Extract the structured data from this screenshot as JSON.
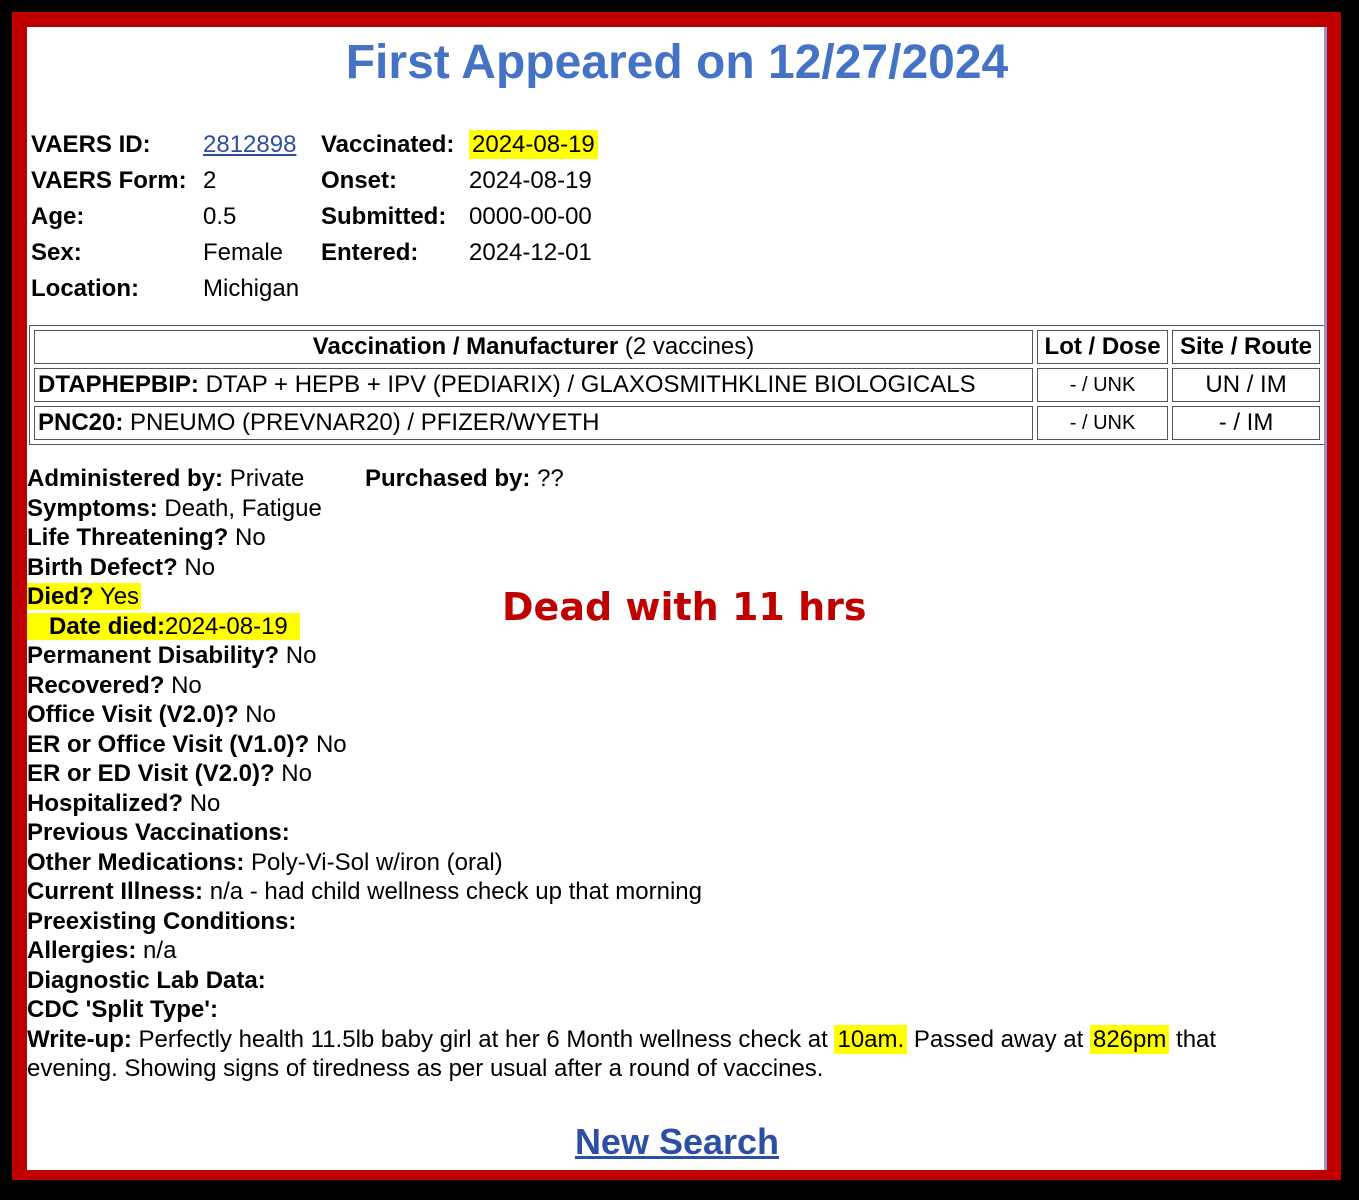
{
  "title": "First Appeared on 12/27/2024",
  "info": {
    "vaers_id_label": "VAERS ID:",
    "vaers_id": "2812898",
    "vaers_form_label": "VAERS Form:",
    "vaers_form": "2",
    "age_label": "Age:",
    "age": "0.5",
    "sex_label": "Sex:",
    "sex": "Female",
    "location_label": "Location:",
    "location": "Michigan",
    "vaccinated_label": "Vaccinated:",
    "vaccinated": "2024-08-19",
    "onset_label": "Onset:",
    "onset": "2024-08-19",
    "submitted_label": "Submitted:",
    "submitted": "0000-00-00",
    "entered_label": "Entered:",
    "entered": "2024-12-01"
  },
  "vaccines": {
    "header_main": "Vaccination / Manufacturer",
    "header_count": "(2 vaccines)",
    "header_lot": "Lot / Dose",
    "header_site": "Site / Route",
    "rows": [
      {
        "code": "DTAPHEPBIP:",
        "desc": "DTAP + HEPB + IPV (PEDIARIX) / GLAXOSMITHKLINE BIOLOGICALS",
        "lot": "- / UNK",
        "site": "UN / IM"
      },
      {
        "code": "PNC20:",
        "desc": "PNEUMO (PREVNAR20) / PFIZER/WYETH",
        "lot": "- / UNK",
        "site": "- / IM"
      }
    ]
  },
  "details": {
    "administered_label": "Administered by:",
    "administered": "Private",
    "purchased_label": "Purchased by:",
    "purchased": "??",
    "symptoms_label": "Symptoms:",
    "symptoms": "Death, Fatigue",
    "life_threatening_label": "Life Threatening?",
    "life_threatening": "No",
    "birth_defect_label": "Birth Defect?",
    "birth_defect": "No",
    "died_label": "Died?",
    "died": "Yes",
    "date_died_label": "Date died:",
    "date_died": "2024-08-19",
    "permanent_disability_label": "Permanent Disability?",
    "permanent_disability": "No",
    "recovered_label": "Recovered?",
    "recovered": "No",
    "office_visit_label": "Office Visit (V2.0)?",
    "office_visit": "No",
    "er_office_label": "ER or Office Visit (V1.0)?",
    "er_office": "No",
    "er_ed_label": "ER or ED Visit (V2.0)?",
    "er_ed": "No",
    "hospitalized_label": "Hospitalized?",
    "hospitalized": "No",
    "previous_vaccinations_label": "Previous Vaccinations:",
    "other_medications_label": "Other Medications:",
    "other_medications": "Poly-Vi-Sol w/iron (oral)",
    "current_illness_label": "Current Illness:",
    "current_illness": "n/a - had child wellness check up that morning",
    "preexisting_label": "Preexisting Conditions:",
    "allergies_label": "Allergies:",
    "allergies": "n/a",
    "diagnostic_label": "Diagnostic Lab Data:",
    "split_type_label": "CDC 'Split Type':",
    "writeup_label": "Write-up:",
    "writeup_part1": "Perfectly health 11.5lb baby girl at her 6 Month wellness check at",
    "writeup_time1": "10am.",
    "writeup_part2": "Passed away at",
    "writeup_time2": "826pm",
    "writeup_part3": "that evening. Showing signs of tiredness as per usual after a round of vaccines."
  },
  "annotation": "Dead with 11 hrs",
  "new_search": "New Search",
  "colors": {
    "title": "#4472c4",
    "link": "#2d4fa1",
    "highlight": "#ffff00",
    "annotation": "#c00000",
    "frame": "#c00000"
  }
}
